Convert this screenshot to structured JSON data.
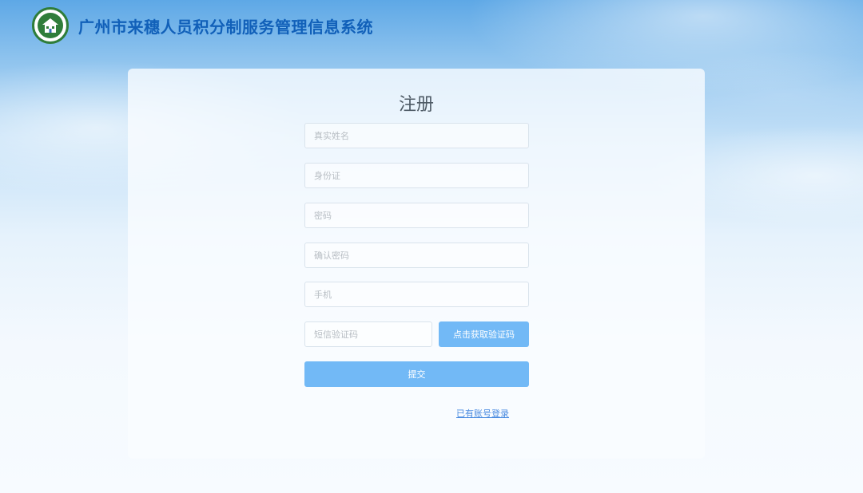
{
  "header": {
    "app_title": "广州市来穗人员积分制服务管理信息系统",
    "logo_icon": "emblem-house-icon"
  },
  "form": {
    "title": "注册",
    "fields": {
      "real_name": {
        "placeholder": "真实姓名",
        "value": ""
      },
      "id_card": {
        "placeholder": "身份证",
        "value": ""
      },
      "password": {
        "placeholder": "密码",
        "value": ""
      },
      "confirm_password": {
        "placeholder": "确认密码",
        "value": ""
      },
      "phone": {
        "placeholder": "手机",
        "value": ""
      },
      "sms_code": {
        "placeholder": "短信验证码",
        "value": ""
      }
    },
    "sms_button_label": "点击获取验证码",
    "submit_label": "提交",
    "login_link": "已有账号登录"
  },
  "colors": {
    "title_blue": "#1160b9",
    "button_blue": "#72b9f6",
    "link_blue": "#4a8be0",
    "logo_green": "#2f7d3a"
  }
}
